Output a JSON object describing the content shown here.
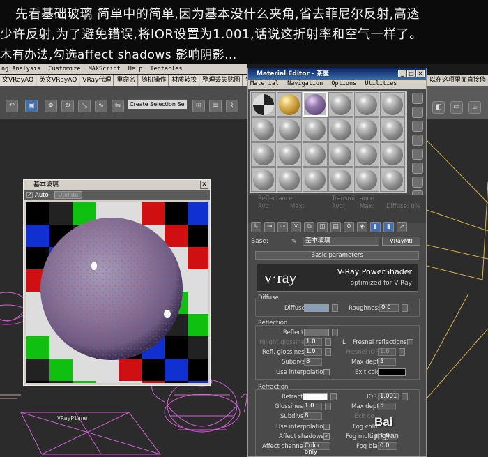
{
  "banner": {
    "line1": "先看基础玻璃  简单中的简单,因为基本没什么夹角,省去菲尼尔反射,高透",
    "line2": "少许反射,为了避免错误,将IOR设置为1.001,话说这折射率和空气一样了。",
    "line3": "木有办法,勾选affect shadows 影响阴影..."
  },
  "max_menu": [
    "ng Analysis",
    "Customize",
    "MAXScript",
    "Help",
    "Tentacles"
  ],
  "max_tabs": [
    "文VRayAO",
    "英文VRayAO",
    "VRay代理",
    "重命名",
    "随机操作",
    "材质转换",
    "整理丢失贴图",
    "特"
  ],
  "right_bar_text": "以在这项里面直接修",
  "selection_set": "Create Selection Se",
  "viewport_label": "VRayPlane",
  "material_editor": {
    "title": "Material Editor - 茶壶",
    "menu": [
      "Material",
      "Navigation",
      "Options",
      "Utilities"
    ],
    "slots": [
      "checker",
      "gold",
      "glass",
      "gray",
      "gray",
      "gray",
      "gray",
      "gray",
      "gray",
      "gray",
      "gray",
      "gray",
      "gray",
      "gray",
      "gray",
      "gray",
      "gray",
      "gray",
      "gray",
      "gray",
      "gray",
      "gray",
      "gray",
      "gray"
    ],
    "faded": {
      "reflectance": "Reflectance",
      "avg": "Avg:",
      "max": "Max:",
      "transmittance": "Transmittance",
      "tavg": "Avg:",
      "tmax": "Max:",
      "diffuse": "Diffuse: 0%",
      "num": "0%"
    },
    "base_label": "Base:",
    "material_name": "基本玻璃",
    "material_type": "VRayMtl",
    "rollout_title": "Basic parameters",
    "vray": {
      "logo": "v·ray",
      "powershader": "V-Ray PowerShader",
      "optimized": "optimized for V-Ray"
    },
    "diffuse": {
      "group": "Diffuse",
      "diffuse_label": "Diffuse",
      "roughness_label": "Roughness",
      "roughness_value": "0.0"
    },
    "reflection": {
      "group": "Reflection",
      "reflect_label": "Reflect",
      "hilight_label": "Hilight glossiness",
      "hilight_value": "1.0",
      "l_label": "L",
      "fresnel_label": "Fresnel reflections",
      "refl_gloss_label": "Refl. glossiness",
      "refl_gloss_value": "1.0",
      "fresnel_ior_label": "Fresnel IOR",
      "fresnel_ior_value": "1.6",
      "subdivs_label": "Subdivs",
      "subdivs_value": "8",
      "max_depth_label": "Max depth",
      "max_depth_value": "5",
      "use_interp_label": "Use interpolation",
      "exit_color_label": "Exit color"
    },
    "refraction": {
      "group": "Refraction",
      "refract_label": "Refract",
      "ior_label": "IOR",
      "ior_value": "1.001",
      "glossiness_label": "Glossiness",
      "glossiness_value": "1.0",
      "max_depth_label": "Max depth",
      "max_depth_value": "5",
      "subdivs_label": "Subdivs",
      "subdivs_value": "8",
      "exit_color_label": "Exit co",
      "use_interp_label": "Use interpolation",
      "fog_color_label": "Fog colo",
      "affect_shadows_label": "Affect shadows",
      "fog_mult_label": "Fog multiplie",
      "fog_mult_value": "1.0",
      "affect_channels_label": "Affect channels",
      "affect_channels_value": "Color only",
      "fog_bias_label": "Fog bias",
      "fog_bias_value": "0.0"
    }
  },
  "preview": {
    "title": "基本玻璃",
    "auto_label": "Auto",
    "update_label": "Update"
  },
  "watermark": {
    "brand": "Bai",
    "sub": "jingyan"
  }
}
